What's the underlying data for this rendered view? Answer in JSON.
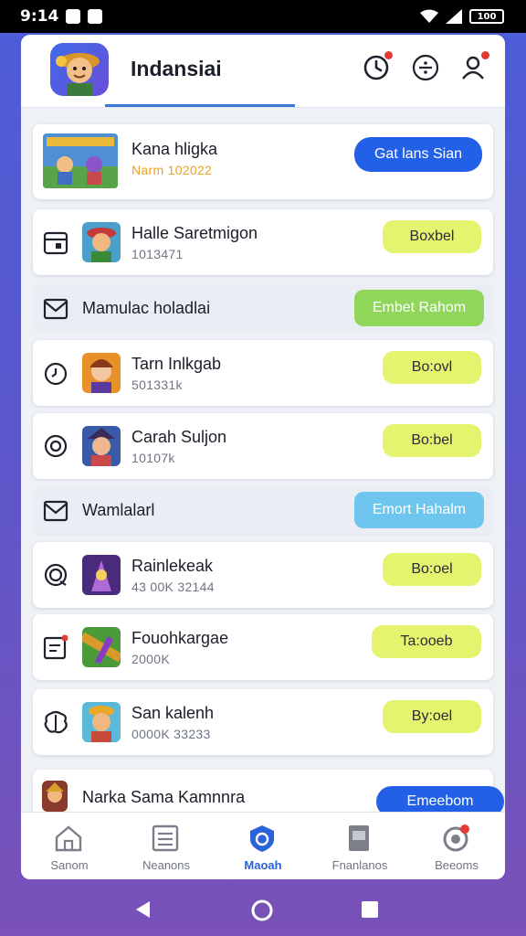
{
  "status_bar": {
    "time": "9:14",
    "battery": "100"
  },
  "header": {
    "title": "Indansiai"
  },
  "featured": {
    "title": "Kana hligka",
    "subtitle": "Narm 102022",
    "button": "Gat lans Sian"
  },
  "rows": [
    {
      "title": "Halle Saretmigon",
      "subtitle": "1013471",
      "button": "Boxbel"
    },
    {
      "title": "Tarn Inlkgab",
      "subtitle": "501331k",
      "button": "Bo:ovl"
    },
    {
      "title": "Carah Suljon",
      "subtitle": "10107k",
      "button": "Bo:bel"
    },
    {
      "title": "Rainlekeak",
      "subtitle": "43 00K 32144",
      "button": "Bo:oel"
    },
    {
      "title": "Fouohkargae",
      "subtitle": "2000K",
      "button": "Ta:ooeb"
    },
    {
      "title": "San kalenh",
      "subtitle": "0000K 33233",
      "button": "By:oel"
    },
    {
      "title": "Narka Sama Kamnnra",
      "subtitle": "",
      "button": "Emeebom"
    }
  ],
  "sections": [
    {
      "title": "Mamulac holadlai",
      "button": "Embet Rahom"
    },
    {
      "title": "Wamlalarl",
      "button": "Emort Hahalm"
    }
  ],
  "bottom_nav": [
    {
      "label": "Sanom",
      "icon": "home-icon"
    },
    {
      "label": "Neanons",
      "icon": "news-icon"
    },
    {
      "label": "Maoah",
      "icon": "shield-icon"
    },
    {
      "label": "Fnanlanos",
      "icon": "document-icon"
    },
    {
      "label": "Beeoms",
      "icon": "profile-gear-icon"
    }
  ],
  "colors": {
    "accent": "#2360e8",
    "pill_yellow": "#e5f46e",
    "pill_green": "#8fd65a",
    "pill_sky": "#6ec6ee",
    "featured_subtitle": "#f0a020",
    "notification_dot": "#e53935"
  }
}
